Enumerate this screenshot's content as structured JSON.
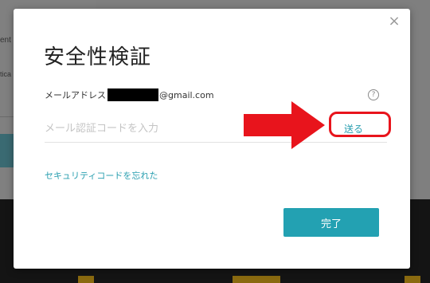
{
  "background": {
    "fragment_top": "ent",
    "fragment_mid": "tica"
  },
  "modal": {
    "title": "安全性検証",
    "email_label": "メールアドレス",
    "email_suffix": "@gmail.com",
    "help_icon": "?",
    "code_placeholder": "メール認証コードを入力",
    "send_label": "送る",
    "forgot_link": "セキュリティコードを忘れた",
    "done_label": "完了",
    "close_symbol": "×"
  },
  "annotation": {
    "color": "#e8141c"
  },
  "colors": {
    "accent": "#23a1b2",
    "link": "#2a9fb0"
  }
}
